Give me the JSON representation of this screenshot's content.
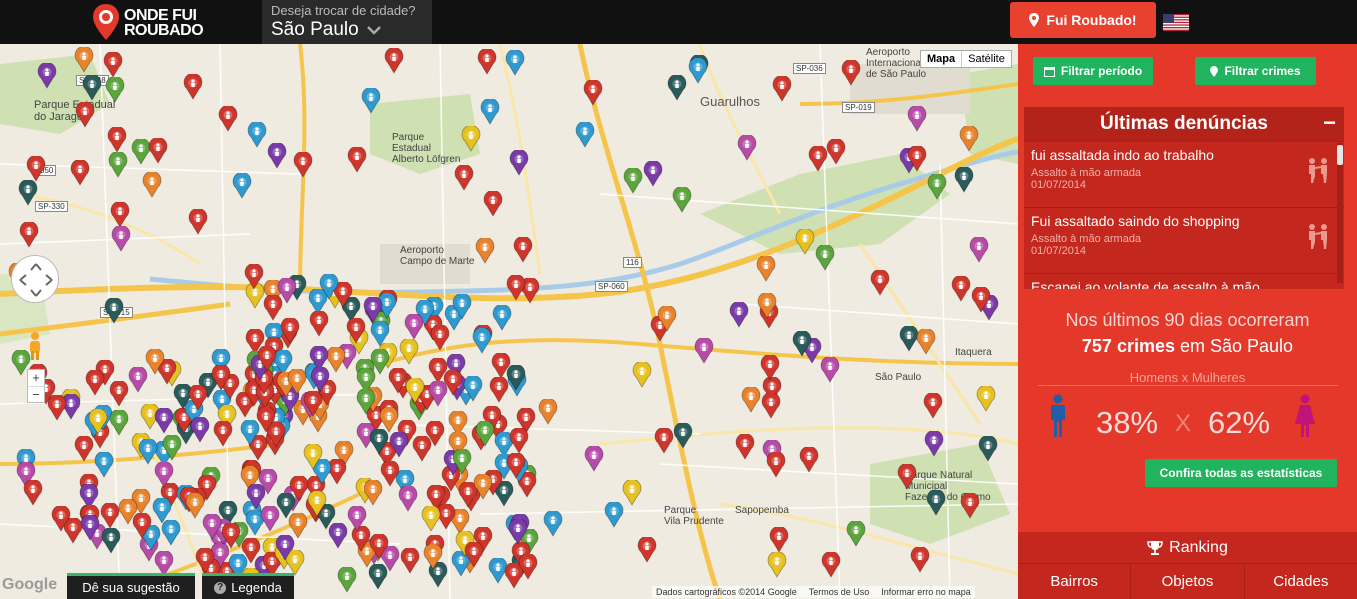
{
  "header": {
    "logo_line1": "ONDE FUI",
    "logo_line2": "ROUBADO",
    "city_prompt": "Deseja trocar de cidade?",
    "city_name": "São Paulo",
    "robbed_button": "Fui Roubado!",
    "language_flag": "us-flag-icon"
  },
  "map": {
    "type_buttons": [
      "Mapa",
      "Satélite"
    ],
    "active_type": "Mapa",
    "zoom_in": "+",
    "zoom_out": "−",
    "google_logo": "Google",
    "suggest_button": "Dê sua sugestão",
    "legend_button": "Legenda",
    "attribution": [
      "Dados cartográficos ©2014 Google",
      "Termos de Uso",
      "Informar erro no mapa"
    ],
    "place_labels": {
      "parque_jaragua": "Parque Estadual\ndo Jaraguá",
      "guarulhos": "Guarulhos",
      "aeroporto_guarulhos": "Aeroporto\nInternacional\nde São Paulo",
      "parque_alberto": "Parque\nEstadual\nAlberto Löfgren",
      "aeroporto_marte": "Aeroporto\nCampo de Marte",
      "sapopemba": "Sapopemba",
      "vila_prudente": "Parque\nVila Prudente",
      "parque_carmo": "Parque Natural\nMunicipal\nFazenda do Carmo",
      "itaquera": "Itaquera",
      "sao_paulo_label": "São Paulo"
    },
    "road_labels": [
      "SP-348",
      "SP-330",
      "SP-015",
      "SP-036",
      "SP-019",
      "SP-060",
      "116",
      "050"
    ],
    "marker_colors": {
      "robbery": "#d0352b",
      "burglary": "#2e9ad0",
      "vehicle": "#e8822b",
      "phone": "#e6c11f",
      "harassment": "#b84aa8",
      "other": "#5aa53c",
      "violence": "#2a5a5a",
      "purple": "#7a3aa8"
    }
  },
  "sidebar": {
    "filter_period": "Filtrar período",
    "filter_crimes": "Filtrar crimes",
    "latest_title": "Últimas denúncias",
    "collapse_label": "−",
    "reports": [
      {
        "title": "fui assaltada indo ao trabalho",
        "type": "Assalto à mão armada",
        "date": "01/07/2014"
      },
      {
        "title": "Fui assaltado saindo do shopping",
        "type": "Assalto à mão armada",
        "date": "01/07/2014"
      },
      {
        "title": "Escapei ao volante de assalto à mão",
        "type": "",
        "date": ""
      }
    ],
    "stats_prefix": "Nos últimos 90 dias ocorreram",
    "stats_count": "757 crimes",
    "stats_city": "em São Paulo",
    "gender_label": "Homens x Mulheres",
    "male_pct": "38%",
    "x_sep": "X",
    "female_pct": "62%",
    "all_stats_button": "Confira todas as estatísticas",
    "ranking_title": "Ranking",
    "ranking_tabs": [
      "Bairros",
      "Objetos",
      "Cidades"
    ],
    "accent": "#e4382a",
    "button_green": "#22b35e"
  }
}
